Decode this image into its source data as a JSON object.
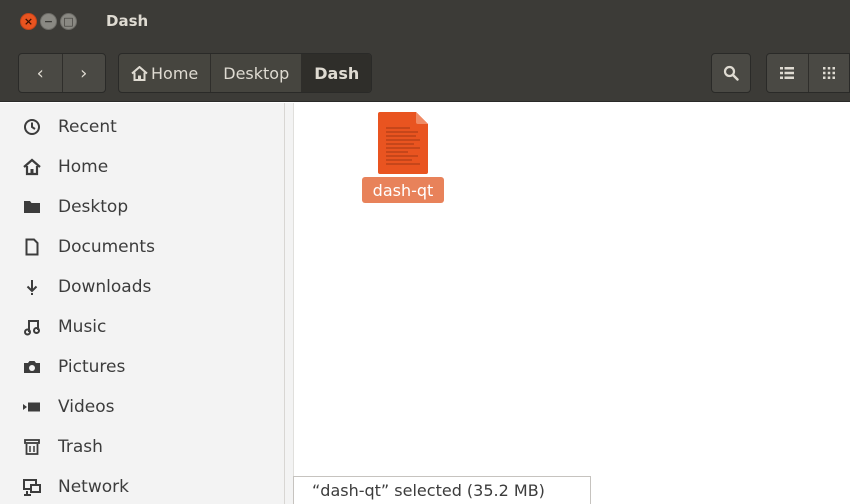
{
  "window": {
    "title": "Dash",
    "close_glyph": "×",
    "min_glyph": "−",
    "max_glyph": "□"
  },
  "toolbar": {
    "back_glyph": "‹",
    "forward_glyph": "›",
    "breadcrumbs": [
      {
        "label": "Home",
        "icon": "home-icon"
      },
      {
        "label": "Desktop"
      },
      {
        "label": "Dash",
        "active": true
      }
    ],
    "search_icon": "search-icon",
    "list_view_icon": "list-view-icon",
    "grid_view_icon": "grid-view-icon"
  },
  "sidebar": {
    "items": [
      {
        "label": "Recent",
        "icon": "clock-icon",
        "glyph": "◷"
      },
      {
        "label": "Home",
        "icon": "home-icon",
        "glyph": "⌂"
      },
      {
        "label": "Desktop",
        "icon": "folder-icon",
        "glyph": "▬"
      },
      {
        "label": "Documents",
        "icon": "document-icon",
        "glyph": "▯"
      },
      {
        "label": "Downloads",
        "icon": "download-icon",
        "glyph": "⇣"
      },
      {
        "label": "Music",
        "icon": "music-icon",
        "glyph": "♫"
      },
      {
        "label": "Pictures",
        "icon": "camera-icon",
        "glyph": "◙"
      },
      {
        "label": "Videos",
        "icon": "video-icon",
        "glyph": "▶"
      },
      {
        "label": "Trash",
        "icon": "trash-icon",
        "glyph": "⌧"
      },
      {
        "label": "Network",
        "icon": "network-icon",
        "glyph": "⊡"
      }
    ]
  },
  "files": [
    {
      "name": "dash-qt",
      "icon": "file-icon",
      "selected": true,
      "color": "#e95420"
    }
  ],
  "status": {
    "text": "“dash-qt” selected  (35.2 MB)"
  },
  "colors": {
    "accent": "#e95420",
    "titlebar": "#3c3b37",
    "selection": "#e8825a"
  }
}
